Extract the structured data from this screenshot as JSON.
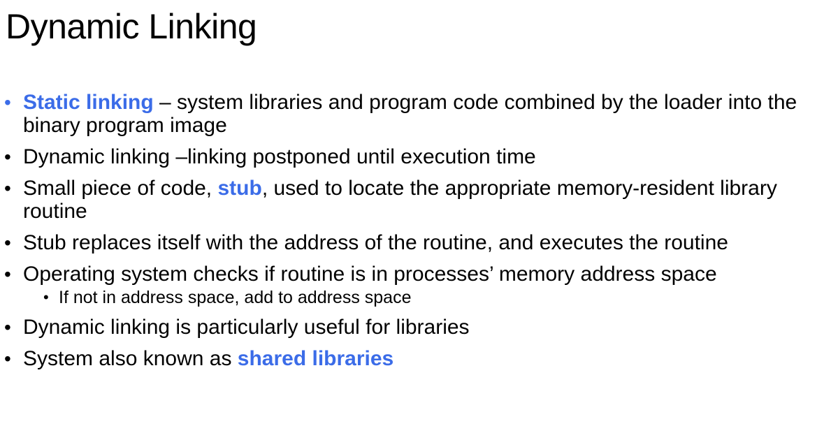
{
  "title": "Dynamic Linking",
  "accent_color": "#3B6CE8",
  "bullet_glyph": "•",
  "bullets": [
    {
      "highlight": "Static linking",
      "rest": " – system libraries and program code combined by the loader into the binary program image"
    },
    {
      "text": "Dynamic linking –linking postponed until execution time"
    },
    {
      "before": "Small piece of code, ",
      "highlight": "stub",
      "after": ", used to locate the appropriate memory-resident library routine"
    },
    {
      "text": "Stub replaces itself with the address of the routine, and executes the routine"
    },
    {
      "text": "Operating system checks if routine is in processes’ memory address space",
      "sub": "If not in address space, add to address space"
    },
    {
      "text": "Dynamic linking is particularly useful for libraries"
    },
    {
      "before": "System also known as ",
      "highlight": "shared libraries"
    }
  ]
}
